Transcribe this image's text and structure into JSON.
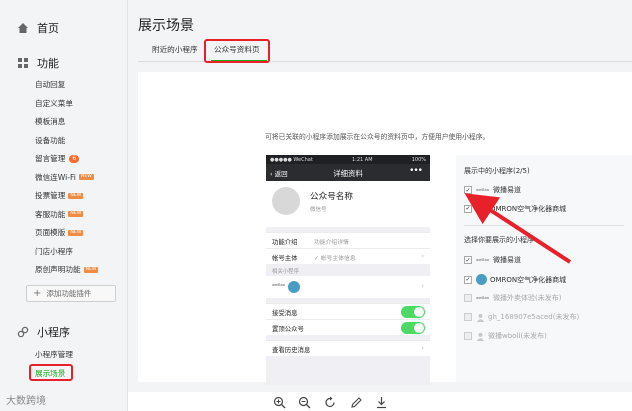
{
  "sidebar": {
    "home": "首页",
    "functions": "功能",
    "function_items": [
      {
        "label": "自动回复"
      },
      {
        "label": "自定义菜单"
      },
      {
        "label": "模板消息"
      },
      {
        "label": "设备功能"
      },
      {
        "label": "留言管理",
        "badge": "6"
      },
      {
        "label": "微信连Wi-Fi",
        "tag": "NEW"
      },
      {
        "label": "投票管理",
        "tag": "NEW"
      },
      {
        "label": "客服功能",
        "tag": "NEW"
      },
      {
        "label": "页面模版",
        "tag": "NEW"
      },
      {
        "label": "门店小程序"
      },
      {
        "label": "原创声明功能",
        "tag": "NEW"
      }
    ],
    "add_plugin": "添加功能插件",
    "miniprogram": "小程序",
    "mp_items": [
      {
        "label": "小程序管理"
      },
      {
        "label": "展示场景"
      }
    ]
  },
  "main": {
    "title": "展示场景",
    "tabs": [
      {
        "label": "附近的小程序"
      },
      {
        "label": "公众号资料页"
      }
    ],
    "description": "可将已关联的小程序添加展示在公众号的资料页中，方便用户使用小程序。"
  },
  "phone": {
    "carrier": "●●●●● WeChat",
    "time": "1:21 AM",
    "battery": "100%",
    "back": "返回",
    "title": "详细资料",
    "more": "•••",
    "account_name": "公众号名称",
    "account_id": "微信号",
    "intro_label": "功能介绍",
    "intro_value": "功能介绍详情",
    "owner_label": "帐号主体",
    "owner_value": "帐号主体信息",
    "related_head": "相关小程序",
    "mp_logo_text": "weiBao",
    "receive_msg": "接受消息",
    "pin_account": "置顶公众号",
    "history": "查看历史消息"
  },
  "panel": {
    "showing_head": "展示中的小程序(2/5)",
    "showing": [
      {
        "logo": "weiBao",
        "label": "微播易道",
        "checked": true
      },
      {
        "logo": "omron",
        "label": "OMRON空气净化器商城",
        "checked": true
      }
    ],
    "choose_head": "选择你要展示的小程序",
    "choose": [
      {
        "logo": "weiBao",
        "label": "微播易道",
        "checked": true,
        "disabled": false
      },
      {
        "logo": "omron",
        "label": "OMRON空气净化器商城",
        "checked": true,
        "disabled": false
      },
      {
        "logo": "weiBao",
        "label": "微播外卖体验(未发布)",
        "checked": false,
        "disabled": true
      },
      {
        "logo": "user",
        "label": "gh_168907e5aced(未发布)",
        "checked": false,
        "disabled": true
      },
      {
        "logo": "user",
        "label": "微播wboll(未发布)",
        "checked": false,
        "disabled": true
      }
    ]
  },
  "toolbar": {
    "icons": [
      "zoom-in-icon",
      "zoom-out-icon",
      "rotate-icon",
      "edit-icon",
      "download-icon"
    ]
  },
  "watermark": "大数跨境",
  "colors": {
    "accent_green": "#1aad19",
    "highlight_red": "#e8202a",
    "toggle_green": "#4cd964",
    "nav_dark": "#2b2c30"
  }
}
